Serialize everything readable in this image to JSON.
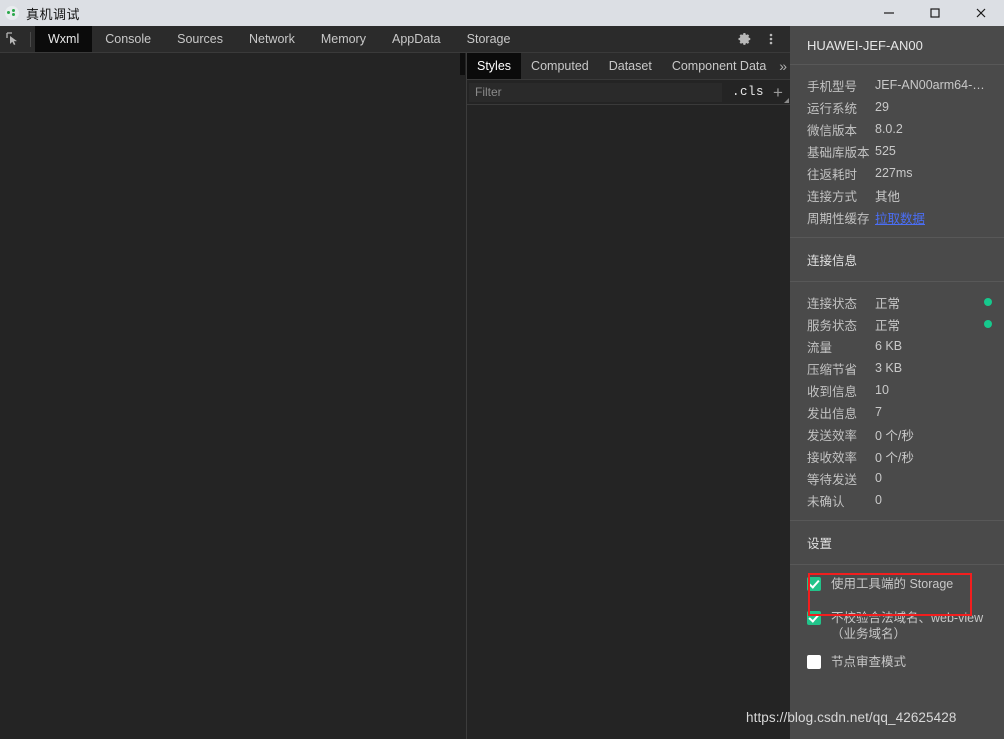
{
  "window": {
    "title": "真机调试",
    "app_icon": "wechat-devtools-icon",
    "controls": [
      {
        "name": "minimize",
        "glyph": "minimize-icon"
      },
      {
        "name": "maximize",
        "glyph": "maximize-icon"
      },
      {
        "name": "close",
        "glyph": "close-icon"
      }
    ]
  },
  "devtools": {
    "inspect_icon": "inspect-element-icon",
    "tabs": [
      {
        "label": "Wxml",
        "active": true
      },
      {
        "label": "Console",
        "active": false
      },
      {
        "label": "Sources",
        "active": false
      },
      {
        "label": "Network",
        "active": false
      },
      {
        "label": "Memory",
        "active": false
      },
      {
        "label": "AppData",
        "active": false
      },
      {
        "label": "Storage",
        "active": false
      }
    ],
    "settings_icon": "gear-icon",
    "more_icon": "more-vertical-icon"
  },
  "styles_pane": {
    "tabs": [
      {
        "label": "Styles",
        "active": true
      },
      {
        "label": "Computed",
        "active": false
      },
      {
        "label": "Dataset",
        "active": false
      },
      {
        "label": "Component Data",
        "active": false
      }
    ],
    "overflow_label": "»",
    "filter": {
      "placeholder": "Filter",
      "value": ""
    },
    "cls_label": ".cls",
    "add_label": "+"
  },
  "device": {
    "name": "HUAWEI-JEF-AN00",
    "info": [
      {
        "label": "手机型号",
        "value": "JEF-AN00arm64-…"
      },
      {
        "label": "运行系统",
        "value": "29"
      },
      {
        "label": "微信版本",
        "value": "8.0.2"
      },
      {
        "label": "基础库版本",
        "value": "525"
      },
      {
        "label": "往返耗时",
        "value": "227ms"
      },
      {
        "label": "连接方式",
        "value": "其他"
      },
      {
        "label": "周期性缓存",
        "value": "拉取数据",
        "link": true
      }
    ],
    "connection_section_title": "连接信息",
    "connection": [
      {
        "label": "连接状态",
        "value": "正常",
        "dot": true
      },
      {
        "label": "服务状态",
        "value": "正常",
        "dot": true
      },
      {
        "label": "流量",
        "value": "6 KB"
      },
      {
        "label": "压缩节省",
        "value": "3 KB"
      },
      {
        "label": "收到信息",
        "value": "10"
      },
      {
        "label": "发出信息",
        "value": "7"
      },
      {
        "label": "发送效率",
        "value": "0 个/秒"
      },
      {
        "label": "接收效率",
        "value": "0 个/秒"
      },
      {
        "label": "等待发送",
        "value": "0"
      },
      {
        "label": "未确认",
        "value": "0"
      }
    ],
    "settings_section_title": "设置",
    "settings": [
      {
        "label": "使用工具端的 Storage",
        "checked": true,
        "highlighted": false
      },
      {
        "label": "不校验合法域名、web-view（业务域名）",
        "checked": true,
        "highlighted": true
      },
      {
        "label": "节点审查模式",
        "checked": false,
        "highlighted": false
      }
    ]
  },
  "colors": {
    "titlebar_bg": "#dcdfe4",
    "devtools_bg": "#242424",
    "tabstrip_bg": "#2b2b2b",
    "active_tab_bg": "#0b0b0b",
    "panel_bg": "#4a4a4a",
    "status_green": "#16c98d",
    "checkbox_green": "#22c38a",
    "link_blue": "#4a6ef5",
    "highlight_red": "#f21e1e"
  },
  "watermark": "https://blog.csdn.net/qq_42625428"
}
